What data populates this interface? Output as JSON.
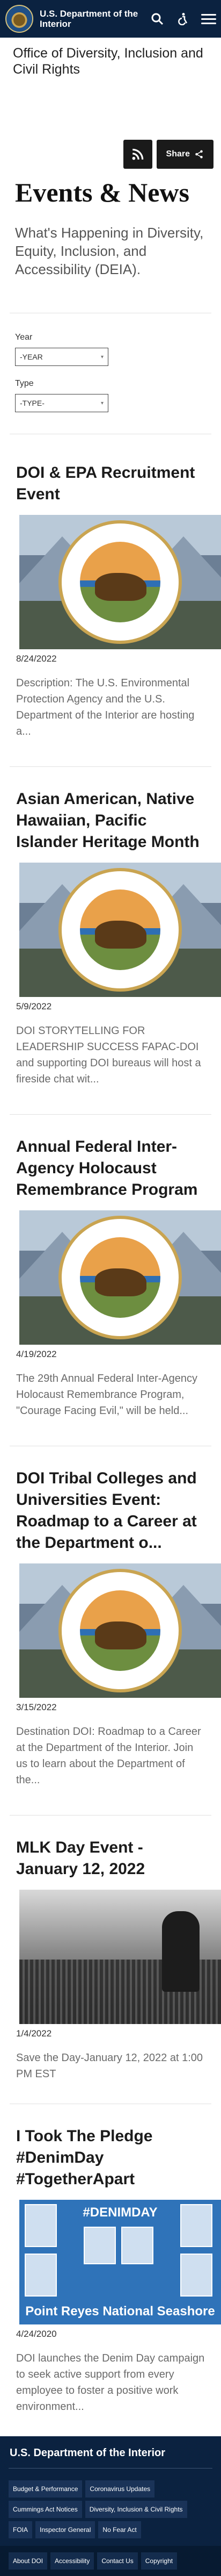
{
  "header": {
    "brand": "U.S. Department of the Interior",
    "icons": [
      "search-icon",
      "accessibility-icon",
      "menu-icon"
    ]
  },
  "office_title": "Office of Diversity, Inclusion and Civil Rights",
  "share": {
    "label": "Share"
  },
  "page": {
    "title": "Events & News",
    "subtitle": "What's Happening in Diversity, Equity, Inclusion, and Accessibility (DEIA)."
  },
  "filters": {
    "year_label": "Year",
    "year_value": "-YEAR",
    "type_label": "Type",
    "type_value": "-TYPE-"
  },
  "events": [
    {
      "title": "DOI & EPA Recruitment Event",
      "date": "8/24/2022",
      "description": "Description: The U.S. Environmental Protection Agency and the U.S. Department of the Interior are hosting a..."
    },
    {
      "title": "Asian American, Native Hawaiian, Pacific Islander Heritage Month",
      "date": "5/9/2022",
      "description": "DOI STORYTELLING FOR LEADERSHIP SUCCESS FAPAC-DOI and supporting DOI bureaus will host a fireside chat wit..."
    },
    {
      "title": "Annual Federal Inter-Agency Holocaust Remembrance Program",
      "date": "4/19/2022",
      "description": "The 29th Annual Federal Inter-Agency Holocaust Remembrance Program, \"Courage Facing Evil,\" will be held..."
    },
    {
      "title": "DOI Tribal Colleges and Universities Event: Roadmap to a Career at the Department o...",
      "date": "3/15/2022",
      "description": "Destination DOI: Roadmap to a Career at the Department of the Interior. Join us to learn about the Department of the..."
    },
    {
      "title": "MLK Day Event - January 12, 2022",
      "date": "1/4/2022",
      "description": "Save the Day-January 12, 2022 at 1:00 PM EST"
    },
    {
      "title": "I Took The Pledge #DenimDay #TogetherApart",
      "date": "4/24/2020",
      "description": "DOI launches the Denim Day campaign to seek active support from every employee to foster a positive work environment...",
      "image_title": "#DENIMDAY",
      "image_caption": "Point Reyes National Seashore"
    }
  ],
  "footer": {
    "title": "U.S. Department of the Interior",
    "links": [
      "Budget & Performance",
      "Coronavirus Updates",
      "Cummings Act Notices",
      "Diversity, Inclusion & Civil Rights",
      "FOIA",
      "Inspector General",
      "No Fear Act"
    ],
    "bottom_links": [
      "About DOI",
      "Accessibility",
      "Contact Us",
      "Copyright"
    ]
  }
}
